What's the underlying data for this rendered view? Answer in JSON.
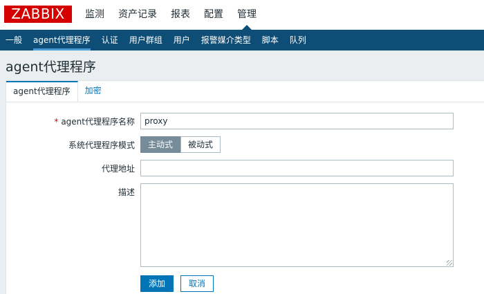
{
  "brand": {
    "logo_text": "ZABBIX",
    "color": "#d40000"
  },
  "top_menu": {
    "items": [
      "监测",
      "资产记录",
      "报表",
      "配置",
      "管理"
    ],
    "active": "管理"
  },
  "sub_menu": {
    "items": [
      "一般",
      "agent代理程序",
      "认证",
      "用户群组",
      "用户",
      "报警媒介类型",
      "脚本",
      "队列"
    ],
    "active": "agent代理程序"
  },
  "page": {
    "title": "agent代理程序"
  },
  "tabs": {
    "items": [
      "agent代理程序",
      "加密"
    ],
    "active": "agent代理程序"
  },
  "form": {
    "name_label": "agent代理程序名称",
    "name_value": "proxy",
    "mode_label": "系统代理程序模式",
    "mode_options": [
      "主动式",
      "被动式"
    ],
    "mode_selected": "主动式",
    "address_label": "代理地址",
    "address_value": "",
    "description_label": "描述",
    "description_value": "",
    "add_button": "添加",
    "cancel_button": "取消"
  },
  "colors": {
    "header_bg": "#0e4d75",
    "accent": "#0275b8",
    "selected_mode_bg": "#768d99"
  }
}
